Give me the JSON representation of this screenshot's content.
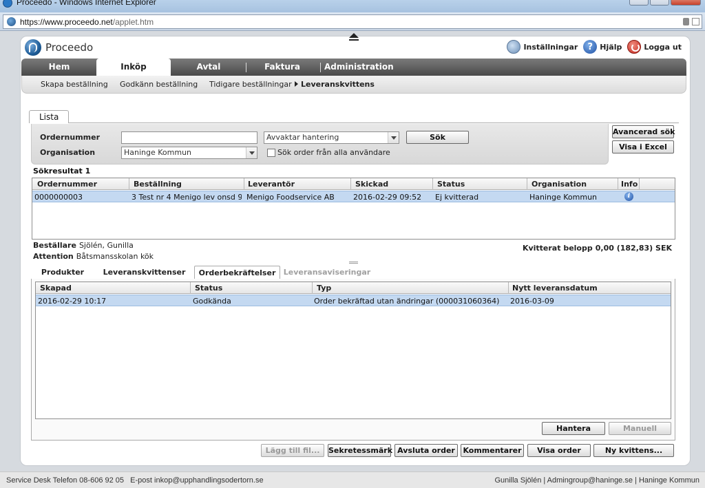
{
  "browser": {
    "window_title": "Proceedo - Windows Internet Explorer",
    "url_prefix": "https://www.",
    "url_domain": "proceedo.net",
    "url_path": "/applet.htm"
  },
  "app": {
    "logo_text": "Proceedo",
    "toplinks": {
      "settings": "Inställningar",
      "help": "Hjälp",
      "logout": "Logga ut"
    },
    "mainnav": [
      "Hem",
      "Inköp",
      "Avtal",
      "Faktura",
      "Administration"
    ],
    "mainnav_active": "Inköp",
    "subnav": [
      "Skapa beställning",
      "Godkänn beställning",
      "Tidigare beställningar",
      "Leveranskvittens"
    ],
    "subnav_active": "Leveranskvittens"
  },
  "list_tab": "Lista",
  "search": {
    "ordernummer_label": "Ordernummer",
    "ordernummer_value": "",
    "organisation_label": "Organisation",
    "organisation_value": "Haninge Kommun",
    "status_value": "Avvaktar hantering",
    "search_button": "Sök",
    "all_users_checkbox": "Sök order från alla användare",
    "advanced_search_button": "Avancerad sök",
    "excel_button": "Visa i Excel"
  },
  "results": {
    "label": "Sökresultat 1",
    "columns": [
      "Ordernummer",
      "Beställning",
      "Leverantör",
      "Skickad",
      "Status",
      "Organisation",
      "Info"
    ],
    "rows": [
      {
        "ordernummer": "0000000003",
        "bestallning": "3 Test nr 4 Menigo lev onsd 9 ...",
        "leverantor": "Menigo Foodservice AB",
        "skickad": "2016-02-29 09:52",
        "status": "Ej kvitterad",
        "organisation": "Haninge Kommun"
      }
    ]
  },
  "details": {
    "bestallare_label": "Beställare",
    "bestallare_value": "Sjölén, Gunilla",
    "attention_label": "Attention",
    "attention_value": "Båtsmansskolan kök",
    "kvitterat_label": "Kvitterat belopp",
    "kvitterat_value": "0,00 (182,83) SEK"
  },
  "lower_tabs": [
    "Produkter",
    "Leveranskvittenser",
    "Orderbekräftelser",
    "Leveransaviseringar"
  ],
  "lower_tab_active": "Orderbekräftelser",
  "confirmations": {
    "columns": [
      "Skapad",
      "Status",
      "Typ",
      "Nytt leveransdatum"
    ],
    "rows": [
      {
        "skapad": "2016-02-29 10:17",
        "status": "Godkända",
        "typ": "Order bekräftad utan ändringar (000031060364)",
        "nytt": "2016-03-09"
      }
    ],
    "hantera_button": "Hantera",
    "manuell_button": "Manuell"
  },
  "actions": [
    "Lägg till fil...",
    "Sekretessmärk",
    "Avsluta order",
    "Kommentarer",
    "Visa order",
    "Ny kvittens..."
  ],
  "footer": {
    "left": "Service Desk Telefon 08-606 92 05   E-post inkop@upphandlingsodertorn.se",
    "right": "Gunilla Sjölén | Admingroup@haninge.se | Haninge Kommun"
  }
}
